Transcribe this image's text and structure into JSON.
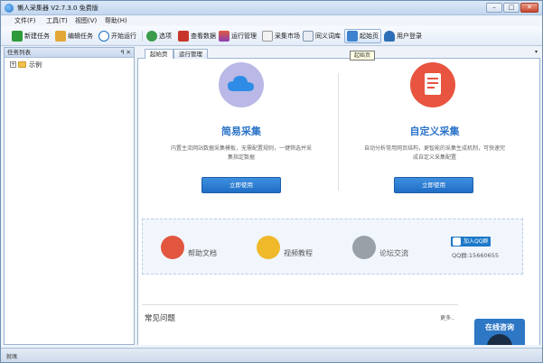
{
  "window": {
    "title": "懒人采集器 V2.7.3.0 免费版",
    "controls": {
      "minimize": "–",
      "maximize": "□",
      "close": "✕"
    }
  },
  "menu": [
    {
      "label": "文件(F)"
    },
    {
      "label": "工具(T)"
    },
    {
      "label": "视图(V)"
    },
    {
      "label": "帮助(H)"
    }
  ],
  "toolbar": {
    "items": [
      {
        "label": "新建任务",
        "icon": "add-task-icon"
      },
      {
        "label": "编辑任务",
        "icon": "edit-task-icon"
      },
      {
        "label": "开始运行",
        "icon": "play-icon"
      },
      {
        "label": "选项",
        "icon": "options-gear-icon"
      },
      {
        "label": "查看数据",
        "icon": "view-data-icon"
      },
      {
        "label": "运行管理",
        "icon": "run-manage-icon"
      },
      {
        "label": "采集市场",
        "icon": "market-icon"
      },
      {
        "label": "同义词库",
        "icon": "synonym-icon"
      },
      {
        "label": "起始页",
        "icon": "home-icon"
      },
      {
        "label": "用户登录",
        "icon": "user-icon"
      }
    ],
    "tooltip": "起始页"
  },
  "left_panel": {
    "title": "任务列表",
    "header_buttons": "ꟼ ✕",
    "tree": [
      {
        "expander": "+",
        "label": "示例"
      }
    ]
  },
  "tabs": [
    {
      "label": "起始页",
      "active": true
    },
    {
      "label": "运行管理",
      "active": false
    }
  ],
  "tab_menu_arrow": "▾",
  "start_page": {
    "simple": {
      "title": "简易采集",
      "desc": "内置主流网站数据采集模板，无需配置规则，一键筛选并采集指定数据",
      "button": "立即使用",
      "color": "#b9b8e6"
    },
    "custom": {
      "title": "自定义采集",
      "desc": "自动分析常用网页结构，更智能的采集生成机制，可快速完成自定义采集配置",
      "button": "立即使用",
      "color": "#e8543f"
    },
    "links": [
      {
        "label": "帮助文档",
        "icon": "help-doc-icon",
        "color": "#e2553f"
      },
      {
        "label": "视频教程",
        "icon": "video-tutorial-icon",
        "color": "#f0b92a"
      },
      {
        "label": "论坛交流",
        "icon": "forum-icon",
        "color": "#9aa0a8"
      }
    ],
    "qq": {
      "join": "加入QQ群",
      "number": "QQ群:15660655"
    },
    "faq": {
      "title": "常见问题",
      "more": "更多.."
    },
    "online": {
      "title": "在线咨询"
    }
  },
  "status": {
    "text": "就绪"
  },
  "colors": {
    "accent": "#2b73c7",
    "button": "#1f6ec6"
  }
}
